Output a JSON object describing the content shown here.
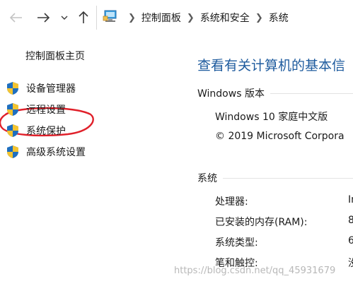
{
  "nav": {
    "back_icon": "back-arrow-icon",
    "forward_icon": "forward-arrow-icon",
    "recent_icon": "chevron-down-icon",
    "up_icon": "up-arrow-icon"
  },
  "breadcrumb": {
    "icon": "control-panel-icon",
    "items": [
      "控制面板",
      "系统和安全",
      "系统"
    ]
  },
  "sidebar": {
    "home": "控制面板主页",
    "items": [
      {
        "label": "设备管理器",
        "icon": "shield-icon"
      },
      {
        "label": "远程设置",
        "icon": "shield-icon"
      },
      {
        "label": "系统保护",
        "icon": "shield-icon"
      },
      {
        "label": "高级系统设置",
        "icon": "shield-icon"
      }
    ]
  },
  "main": {
    "title": "查看有关计算机的基本信",
    "edition": {
      "heading": "Windows 版本",
      "name": "Windows 10 家庭中文版",
      "copyright": "© 2019 Microsoft Corpora"
    },
    "system": {
      "heading": "系统",
      "rows": [
        {
          "label": "处理器:",
          "value": "In"
        },
        {
          "label": "已安装的内存(RAM):",
          "value": "8"
        },
        {
          "label": "系统类型:",
          "value": "6"
        },
        {
          "label": "笔和触控:",
          "value": "没"
        }
      ]
    }
  },
  "watermark": "https://blog.csdn.net/qq_45931679",
  "colors": {
    "title_blue": "#1e5b9e",
    "annotation_red": "#e0202a"
  }
}
